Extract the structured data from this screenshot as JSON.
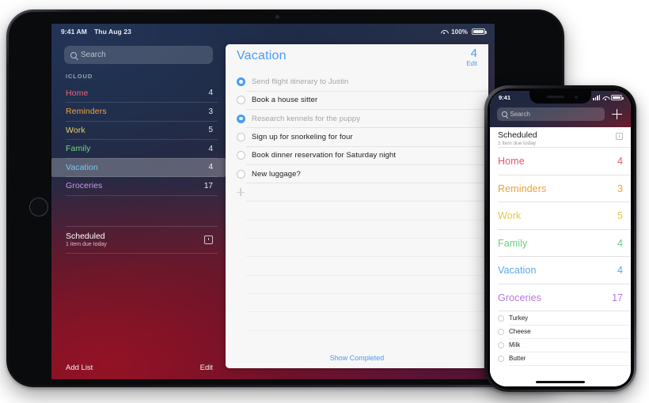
{
  "ipad": {
    "status": {
      "time": "9:41 AM",
      "date": "Thu Aug 23",
      "battery_pct": "100%",
      "wifi_icon": "wifi-icon",
      "battery_icon": "battery-icon"
    },
    "sidebar": {
      "search": {
        "placeholder": "Search",
        "icon": "search-icon"
      },
      "section_header": "ICLOUD",
      "lists": [
        {
          "name": "Home",
          "count": "4",
          "color": "#f2647a"
        },
        {
          "name": "Reminders",
          "count": "3",
          "color": "#f0a33c"
        },
        {
          "name": "Work",
          "count": "5",
          "color": "#e7d268"
        },
        {
          "name": "Family",
          "count": "4",
          "color": "#6fd88a"
        },
        {
          "name": "Vacation",
          "count": "4",
          "color": "#7cc4f5",
          "selected": true
        },
        {
          "name": "Groceries",
          "count": "17",
          "color": "#c79af0"
        }
      ],
      "scheduled": {
        "title": "Scheduled",
        "subtitle": "1 item due today",
        "icon": "alarm-clock-icon"
      },
      "add_list_label": "Add List",
      "edit_label": "Edit"
    },
    "detail": {
      "title": "Vacation",
      "count": "4",
      "edit_label": "Edit",
      "accent": "#4a9bf2",
      "tasks": [
        {
          "text": "Send flight itinerary to Justin",
          "completed": true
        },
        {
          "text": "Book a house sitter",
          "completed": false
        },
        {
          "text": "Research kennels for the puppy",
          "completed": true
        },
        {
          "text": "Sign up for snorkeling for four",
          "completed": false
        },
        {
          "text": "Book dinner reservation for Saturday night",
          "completed": false
        },
        {
          "text": "New luggage?",
          "completed": false
        }
      ],
      "add_icon": "plus-icon",
      "show_completed_label": "Show Completed"
    }
  },
  "iphone": {
    "status": {
      "time": "9:41",
      "signal_icon": "cellular-signal-icon",
      "wifi_icon": "wifi-icon",
      "battery_icon": "battery-icon"
    },
    "search": {
      "placeholder": "Search",
      "icon": "search-icon"
    },
    "add_icon": "plus-icon",
    "scheduled": {
      "title": "Scheduled",
      "subtitle": "1 item due today",
      "icon": "alarm-clock-icon"
    },
    "lists": [
      {
        "name": "Home",
        "count": "4",
        "color": "#f0536e"
      },
      {
        "name": "Reminders",
        "count": "3",
        "color": "#eca13a"
      },
      {
        "name": "Work",
        "count": "5",
        "color": "#e3c84f"
      },
      {
        "name": "Family",
        "count": "4",
        "color": "#66d17f"
      },
      {
        "name": "Vacation",
        "count": "4",
        "color": "#5aa8ef"
      },
      {
        "name": "Groceries",
        "count": "17",
        "color": "#b07ae0"
      }
    ],
    "grocery_items": [
      {
        "text": "Turkey"
      },
      {
        "text": "Cheese"
      },
      {
        "text": "Milk"
      },
      {
        "text": "Butter"
      }
    ]
  }
}
